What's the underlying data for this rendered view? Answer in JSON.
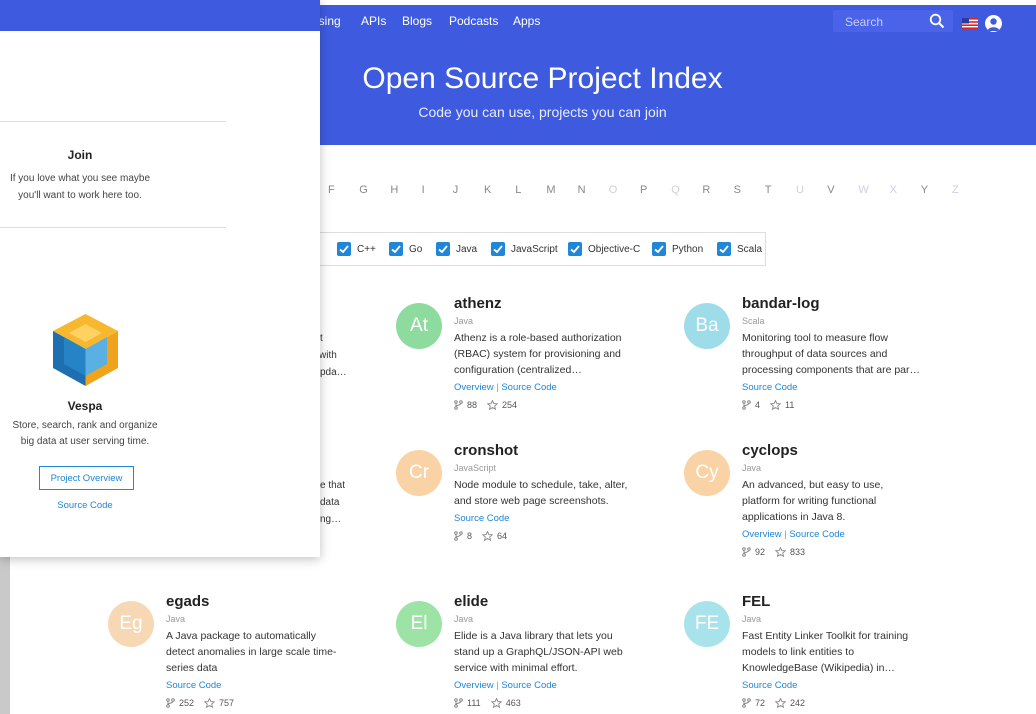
{
  "nav": {
    "links": [
      "ising",
      "APIs",
      "Blogs",
      "Podcasts",
      "Apps"
    ],
    "search_placeholder": "Search"
  },
  "hero": {
    "title": "Open Source Project Index",
    "subtitle": "Code you can use, projects you can join"
  },
  "letters": [
    {
      "l": "F",
      "dim": false
    },
    {
      "l": "G",
      "dim": false
    },
    {
      "l": "H",
      "dim": false
    },
    {
      "l": "I",
      "dim": false
    },
    {
      "l": "J",
      "dim": false
    },
    {
      "l": "K",
      "dim": false
    },
    {
      "l": "L",
      "dim": false
    },
    {
      "l": "M",
      "dim": false
    },
    {
      "l": "N",
      "dim": false
    },
    {
      "l": "O",
      "dim": true
    },
    {
      "l": "P",
      "dim": false
    },
    {
      "l": "Q",
      "dim": true
    },
    {
      "l": "R",
      "dim": false
    },
    {
      "l": "S",
      "dim": false
    },
    {
      "l": "T",
      "dim": false
    },
    {
      "l": "U",
      "dim": true
    },
    {
      "l": "V",
      "dim": false
    },
    {
      "l": "W",
      "dim": true
    },
    {
      "l": "X",
      "dim": true
    },
    {
      "l": "Y",
      "dim": false
    },
    {
      "l": "Z",
      "dim": true
    }
  ],
  "languages": [
    "C++",
    "Go",
    "Java",
    "JavaScript",
    "Objective-C",
    "Python",
    "Scala"
  ],
  "cards": [
    {
      "abbr": "At",
      "color": "#8ddb9f",
      "name": "athenz",
      "lang": "Java",
      "desc": [
        "Athenz is a role-based authorization",
        "(RBAC) system for provisioning and",
        "configuration (centralized…"
      ],
      "links": [
        "Overview",
        "Source Code"
      ],
      "forks": "88",
      "stars": "254"
    },
    {
      "abbr": "Ba",
      "color": "#9fdce9",
      "name": "bandar-log",
      "lang": "Scala",
      "desc": [
        "Monitoring tool to measure flow",
        "throughput of data sources and",
        "processing components that are par…"
      ],
      "links": [
        "Source Code"
      ],
      "forks": "4",
      "stars": "11"
    },
    {
      "abbr": "Cr",
      "color": "#f9d3a5",
      "name": "cronshot",
      "lang": "JavaScript",
      "desc": [
        "Node module to schedule, take, alter,",
        "and store web page screenshots."
      ],
      "links": [
        "Source Code"
      ],
      "forks": "8",
      "stars": "64"
    },
    {
      "abbr": "Cy",
      "color": "#f9d3a5",
      "name": "cyclops",
      "lang": "Java",
      "desc": [
        "An advanced, but easy to use,",
        "platform for writing functional",
        "applications in Java 8."
      ],
      "links": [
        "Overview",
        "Source Code"
      ],
      "forks": "92",
      "stars": "833"
    },
    {
      "abbr": "Eg",
      "color": "#f6d8b4",
      "name": "egads",
      "lang": "Java",
      "desc": [
        "A Java package to automatically",
        "detect anomalies in large scale time-",
        "series data"
      ],
      "links": [
        "Source Code"
      ],
      "forks": "252",
      "stars": "757"
    },
    {
      "abbr": "El",
      "color": "#9ee3a6",
      "name": "elide",
      "lang": "Java",
      "desc": [
        "Elide is a Java library that lets you",
        "stand up a GraphQL/JSON-API web",
        "service with minimal effort."
      ],
      "links": [
        "Overview",
        "Source Code"
      ],
      "forks": "111",
      "stars": "463"
    },
    {
      "abbr": "FE",
      "color": "#a8e3ec",
      "name": "FEL",
      "lang": "Java",
      "desc": [
        "Fast Entity Linker Toolkit for training",
        "models to link entities to",
        "KnowledgeBase (Wikipedia) in…"
      ],
      "links": [
        "Source Code"
      ],
      "forks": "72",
      "stars": "242"
    }
  ],
  "overlay": {
    "join_title": "Join",
    "join_text": [
      "If you love what you see maybe",
      "you'll want to work here too."
    ],
    "vespa_title": "Vespa",
    "vespa_text": [
      "Store, search, rank and organize",
      "big data at user serving time."
    ],
    "overview_button": "Project Overview",
    "source_link": "Source Code"
  },
  "peek_text": [
    "t",
    "with",
    "pda…",
    "e that",
    "data",
    "ng…"
  ],
  "colors": {
    "brand": "#3e5be0",
    "link": "#2086d8"
  }
}
